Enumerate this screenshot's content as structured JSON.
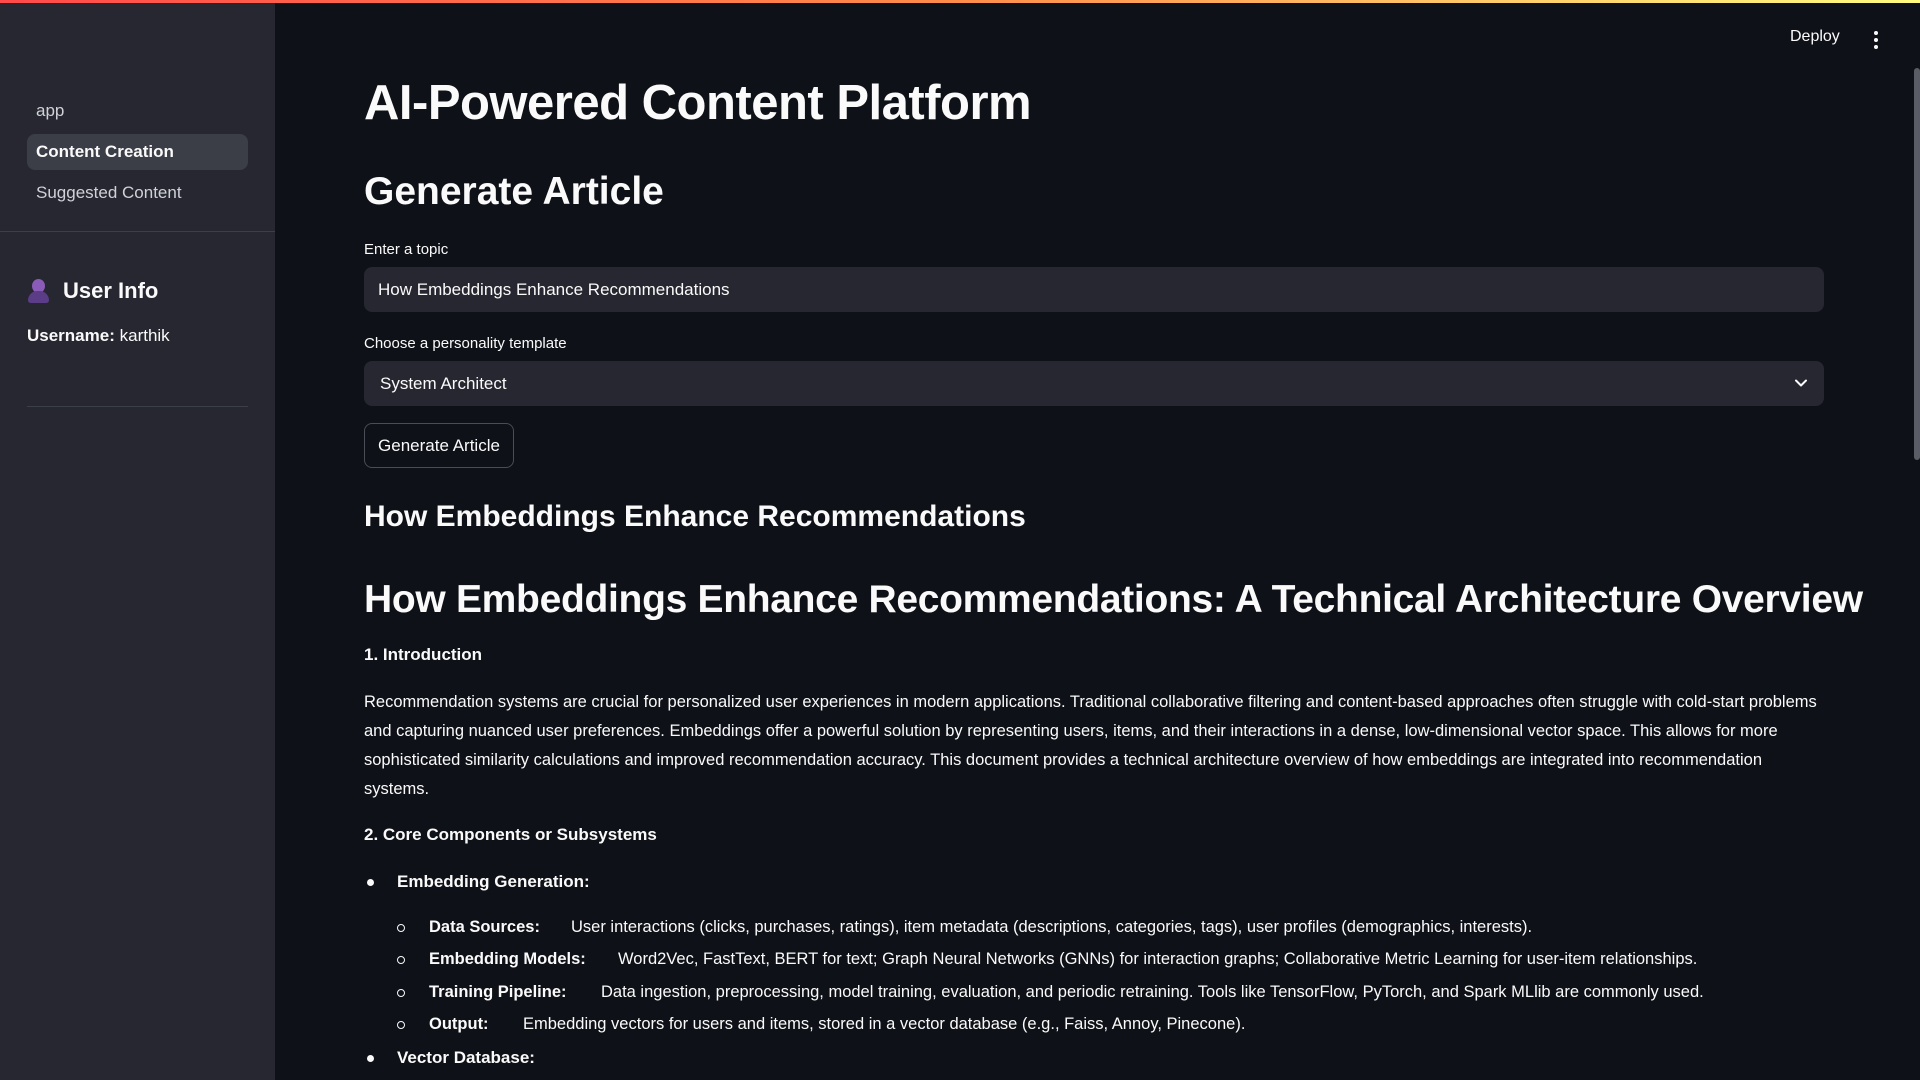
{
  "sidebar": {
    "nav": [
      {
        "label": "app"
      },
      {
        "label": "Content Creation"
      },
      {
        "label": "Suggested Content"
      }
    ],
    "user_info": {
      "title": "User Info",
      "icon": "user-icon",
      "username_label": "Username:",
      "username_value": "karthik"
    }
  },
  "header": {
    "deploy_label": "Deploy",
    "menu_icon": "vertical-dots-icon"
  },
  "main": {
    "title": "AI-Powered Content Platform",
    "section_title": "Generate Article",
    "topic_label": "Enter a topic",
    "topic_value": "How Embeddings Enhance Recommendations",
    "template_label": "Choose a personality template",
    "template_value": "System Architect",
    "generate_button": "Generate Article"
  },
  "article": {
    "subtitle": "How Embeddings Enhance Recommendations",
    "heading": "How Embeddings Enhance Recommendations: A Technical Architecture Overview",
    "intro_heading": "1. Introduction",
    "intro_text": "Recommendation systems are crucial for personalized user experiences in modern applications. Traditional collaborative filtering and content-based approaches often struggle with cold-start problems and capturing nuanced user preferences. Embeddings offer a powerful solution by representing users, items, and their interactions in a dense, low-dimensional vector space. This allows for more sophisticated similarity calculations and improved recommendation accuracy. This document provides a technical architecture overview of how embeddings are integrated into recommendation systems.",
    "core_heading": "2. Core Components or Subsystems",
    "bullets": [
      {
        "label": "Embedding Generation:",
        "items": [
          {
            "label": "Data Sources:",
            "text": "User interactions (clicks, purchases, ratings), item metadata (descriptions, categories, tags), user profiles (demographics, interests)."
          },
          {
            "label": "Embedding Models:",
            "text": "Word2Vec, FastText, BERT for text; Graph Neural Networks (GNNs) for interaction graphs; Collaborative Metric Learning for user-item relationships."
          },
          {
            "label": "Training Pipeline:",
            "text": "Data ingestion, preprocessing, model training, evaluation, and periodic retraining. Tools like TensorFlow, PyTorch, and Spark MLlib are commonly used."
          },
          {
            "label": "Output:",
            "text": "Embedding vectors for users and items, stored in a vector database (e.g., Faiss, Annoy, Pinecone)."
          }
        ]
      },
      {
        "label": "Vector Database:",
        "items": []
      }
    ]
  }
}
